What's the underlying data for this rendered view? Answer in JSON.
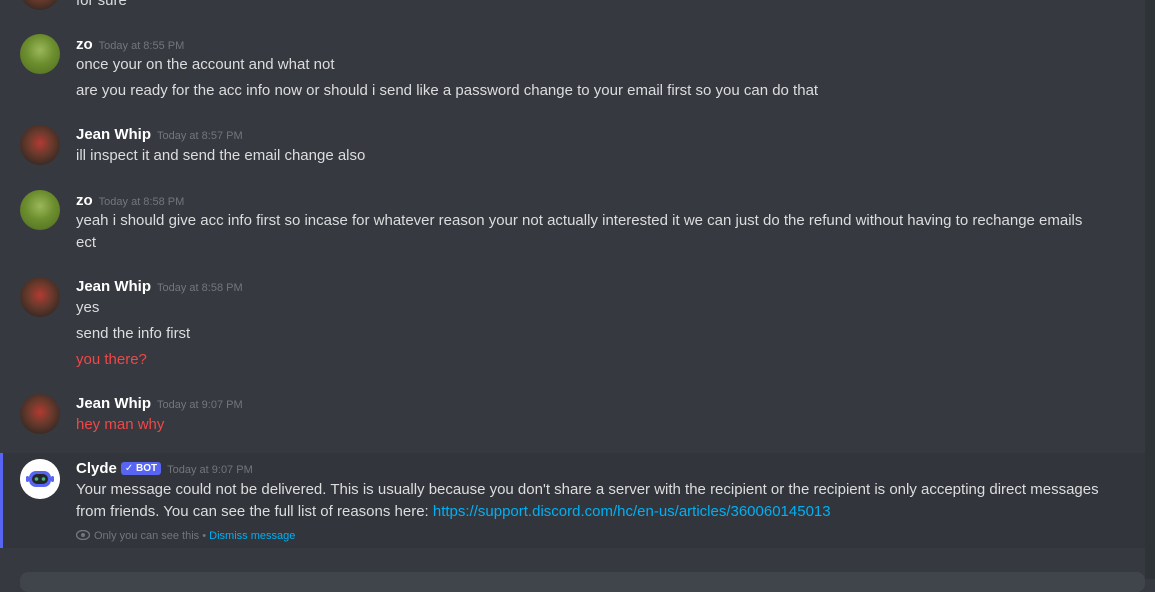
{
  "messages": [
    {
      "user": "",
      "time": "",
      "lines": [
        "for sure"
      ]
    },
    {
      "user": "zo",
      "time": "Today at 8:55 PM",
      "lines": [
        "once your on the account and what not",
        "are you ready for the acc info now or should i send like a password change to your email first so you can do that"
      ]
    },
    {
      "user": "Jean Whip",
      "time": "Today at 8:57 PM",
      "lines": [
        "ill inspect it and send the email change also"
      ]
    },
    {
      "user": "zo",
      "time": "Today at 8:58 PM",
      "lines": [
        "yeah i should give acc info first so incase for whatever reason your not actually interested it we can just do the refund without having to rechange emails",
        "ect"
      ]
    },
    {
      "user": "Jean Whip",
      "time": "Today at 8:58 PM",
      "lines": [
        "yes",
        "send the info first",
        "you there?"
      ]
    },
    {
      "user": "Jean Whip",
      "time": "Today at 9:07 PM",
      "lines": [
        "hey man why"
      ]
    }
  ],
  "clyde": {
    "user": "Clyde",
    "bot_tag": "✓ BOT",
    "time": "Today at 9:07 PM",
    "line1": "Your message could not be delivered. This is usually because you don't share a server with the recipient or the recipient is only accepting direct messages",
    "line2_prefix": "from friends. You can see the full list of reasons here: ",
    "link": "https://support.discord.com/hc/en-us/articles/360060145013",
    "note": "Only you can see this",
    "note_sep": " • ",
    "dismiss": "Dismiss message"
  },
  "colors": {
    "background": "#36393f",
    "error_text": "#f04747",
    "link": "#00b0f4",
    "bot_tag": "#5865f2"
  }
}
